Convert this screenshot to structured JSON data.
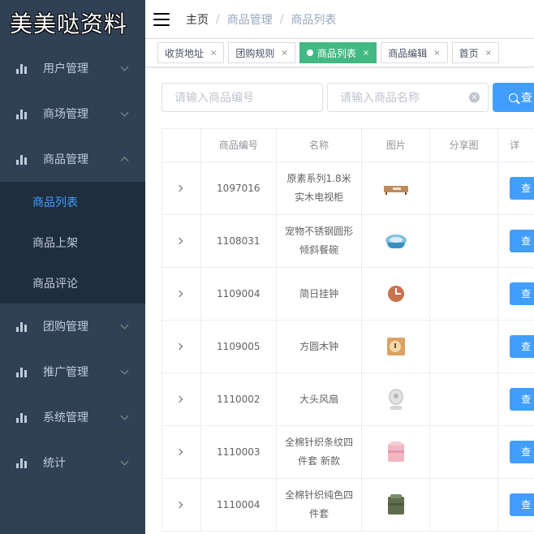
{
  "app": {
    "logo_text": "美美哒资料"
  },
  "colors": {
    "sidebar_bg": "#304156",
    "submenu_bg": "#1f2d3d",
    "accent": "#409eff",
    "tag_active": "#42b983"
  },
  "sidebar": {
    "menus": [
      {
        "label": "用户管理",
        "icon": "bar-chart-icon",
        "expanded": false
      },
      {
        "label": "商场管理",
        "icon": "bar-chart-icon",
        "expanded": false
      },
      {
        "label": "商品管理",
        "icon": "bar-chart-icon",
        "expanded": true,
        "children": [
          {
            "label": "商品列表",
            "active": true
          },
          {
            "label": "商品上架",
            "active": false
          },
          {
            "label": "商品评论",
            "active": false
          }
        ]
      },
      {
        "label": "团购管理",
        "icon": "bar-chart-icon",
        "expanded": false
      },
      {
        "label": "推广管理",
        "icon": "bar-chart-icon",
        "expanded": false
      },
      {
        "label": "系统管理",
        "icon": "bar-chart-icon",
        "expanded": false
      },
      {
        "label": "统计",
        "icon": "bar-chart-icon",
        "expanded": false
      }
    ]
  },
  "breadcrumb": [
    "主页",
    "商品管理",
    "商品列表"
  ],
  "tags": [
    {
      "label": "收货地址",
      "active": false
    },
    {
      "label": "团购规则",
      "active": false
    },
    {
      "label": "商品列表",
      "active": true
    },
    {
      "label": "商品编辑",
      "active": false
    },
    {
      "label": "首页",
      "active": false
    }
  ],
  "filters": {
    "code_placeholder": "请输入商品编号",
    "name_placeholder": "请输入商品名称",
    "search_label": "查"
  },
  "table": {
    "columns": [
      "",
      "商品编号",
      "名称",
      "图片",
      "分享图",
      "详"
    ],
    "view_label": "查",
    "rows": [
      {
        "code": "1097016",
        "name": "原素系列1.8米实木电视柜",
        "image": "tv-stand"
      },
      {
        "code": "1108031",
        "name": "宠物不锈钢圆形倾斜餐碗",
        "image": "pet-bowl"
      },
      {
        "code": "1109004",
        "name": "简日挂钟",
        "image": "wall-clock"
      },
      {
        "code": "1109005",
        "name": "方圆木钟",
        "image": "wood-clock"
      },
      {
        "code": "1110002",
        "name": "大头风扇",
        "image": "fan"
      },
      {
        "code": "1110003",
        "name": "全棉针织条纹四件套 新款",
        "image": "pink-bedding"
      },
      {
        "code": "1110004",
        "name": "全棉针织纯色四件套",
        "image": "green-bedding"
      }
    ]
  }
}
